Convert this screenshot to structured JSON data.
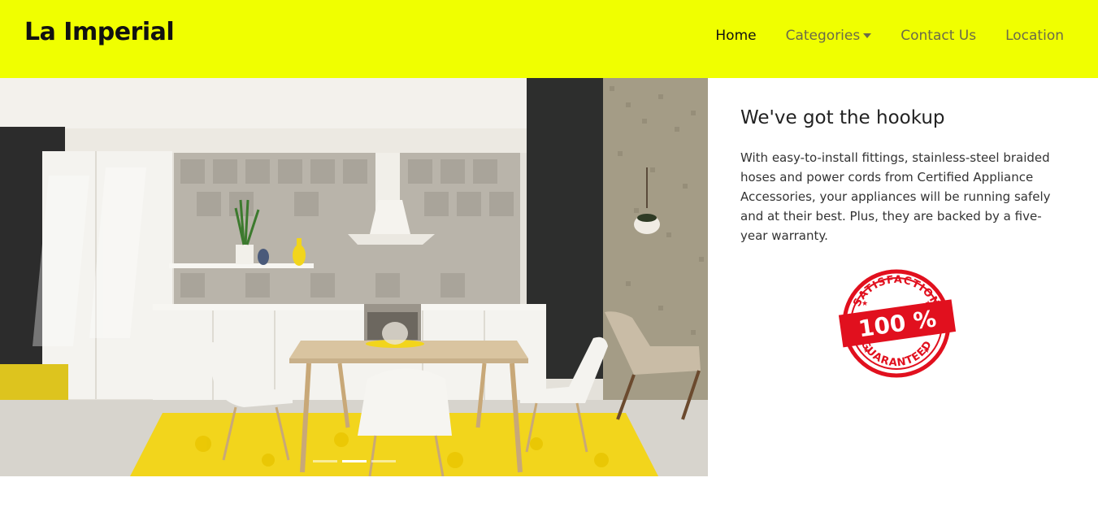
{
  "brand": {
    "name": "La Imperial"
  },
  "nav": {
    "items": [
      {
        "label": "Home"
      },
      {
        "label": "Categories"
      },
      {
        "label": "Contact Us"
      },
      {
        "label": "Location"
      }
    ]
  },
  "carousel": {
    "image_alt": "Kitchen with white cabinets, yellow rug, wooden table and white chairs",
    "slide_count": 3,
    "active_slide": 2
  },
  "feature": {
    "title": "We've got the hookup",
    "body": "With easy-to-install fittings, stainless-steel braided hoses and power cords from Certified Appliance Accessories, your appliances will be running safely and at their best. Plus, they are backed by a five-year warranty."
  },
  "badge": {
    "top_text": "SATISFACTION",
    "center_text": "100 %",
    "bottom_text": "GUARANTEED",
    "color": "#e1101e"
  },
  "colors": {
    "navbar": "#f0ff00",
    "accent_yellow": "#f2d51c",
    "text": "#222222"
  }
}
